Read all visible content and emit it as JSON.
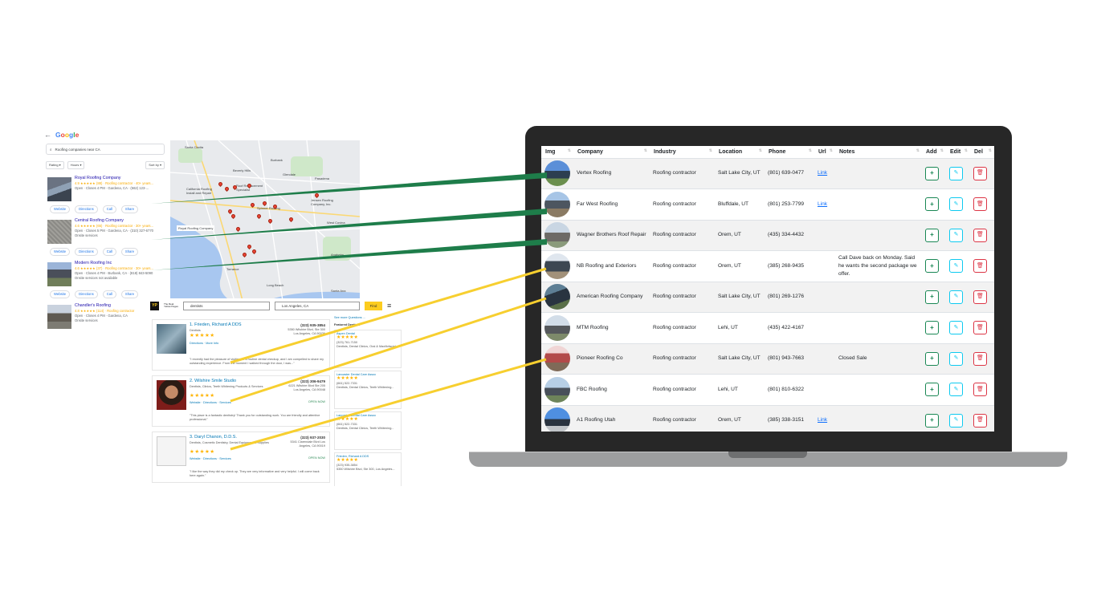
{
  "google": {
    "logo": [
      "G",
      "o",
      "o",
      "g",
      "l",
      "e"
    ],
    "search": "Roofing companies near CA",
    "filters": [
      "Rating ▾",
      "Hours ▾",
      "Sort by ▾"
    ],
    "results": [
      {
        "name": "Royal Roofing Company",
        "line1": "4.9 ★★★★★ (88) · Roofing contractor · 40+ years...",
        "line2": "Open · Closes 4 PM · Gardena, CA · (562) 123-...",
        "actions": [
          "Website",
          "Directions",
          "Call",
          "Share"
        ]
      },
      {
        "name": "Central Roofing Company",
        "line1": "4.6 ★★★★★ (65) · Roofing contractor · 30+ years...",
        "line2": "Open · Closes 5 PM · Gardena, CA · (310) 327-6770",
        "line3": "Onsite services",
        "actions": [
          "Website",
          "Directions",
          "Call",
          "Share"
        ]
      },
      {
        "name": "Modern Roofing Inc",
        "line1": "4.6 ★★★★★ (37) · Roofing contractor · 30+ years...",
        "line2": "Open · Closes 4 PM · Burbank, CA · (818) 843-5090",
        "line3": "Onsite services not available",
        "actions": [
          "Website",
          "Directions",
          "Call",
          "Share"
        ]
      },
      {
        "name": "Chandler's Roofing",
        "line1": "4.8 ★★★★★ (114) · Roofing contractor",
        "line2": "Open · Closes 4 PM · Gardena, CA",
        "line3": "Onsite services"
      }
    ],
    "map_labels": [
      "Santa Clarita",
      "California Roofing Install and Repair",
      "Roof Replacement Specialist",
      "Jensen Roofing Company, Inc.",
      "Spinner Roofing",
      "Royal Roofing Company",
      "Long Beach",
      "Santa Ana",
      "Torrance",
      "Anaheim",
      "Beverly Hills",
      "Glendale",
      "Pasadena",
      "Burbank",
      "West Covina"
    ]
  },
  "yellowpages": {
    "logo": "YP",
    "tagline": "The Real Yellow Pages",
    "search": "dentists",
    "location": "Los Angeles, CA",
    "find": "Find",
    "listings": [
      {
        "name": "1. Frieden, Richard A DDS",
        "sub": "Dentists",
        "phone": "(323) 935-3854",
        "addr": "5350 Wilshire Blvd, Ste 300 Los Angeles, CA 90036",
        "links": "Directions · More Info",
        "review": "\"I recently had the pleasure of visiting for a routine dental checkup, and I am compelled to share my outstanding experience. From the moment I walked through the door, I was...\""
      },
      {
        "name": "2. Wilshire Smile Studio",
        "sub": "Dentists, Clinics, Teeth Whitening Products & Services",
        "phone": "(323) 306-9479",
        "addr": "6221 Wilshire Blvd Ste 205 Los Angeles, CA 90048",
        "links": "Website · Directions · Services",
        "review": "\"This place is a fantastic dentistry! Thank you for outstanding work. You are friendly and attentive professional.\"",
        "status": "OPEN NOW"
      },
      {
        "name": "3. Daryl Chanon, D.D.S.",
        "sub": "Dentists, Cosmetic Dentistry, Dental Equipment & Supplies",
        "phone": "(323) 937-2030",
        "addr": "5341 Clarendale Blvd Los Angeles, CA 90019",
        "links": "Website · Directions · Services",
        "review": "\"I like the way they did my check up. They are very informative and very helpful. I will come back here again.\"",
        "status": "OPEN NOW"
      }
    ],
    "sidebar": {
      "heading": "Featured Dentists",
      "link": "See more Questions ...",
      "items": [
        {
          "name": "Aspen Dental",
          "phone": "(323) 761-7150",
          "desc": "Dentists, Dental Clinics, Oral & Maxillofacial..."
        },
        {
          "name": "Lancaster Dental Care Assoc",
          "phone": "(661) 522-7331",
          "desc": "Dentists, Dental Clinics, Teeth Whitening..."
        },
        {
          "name": "Lancaster Dental Care Assoc",
          "phone": "(661) 522-7331",
          "desc": "Dentists, Dental Clinics, Teeth Whitening..."
        },
        {
          "name": "Frieden, Richard A DDS",
          "phone": "(323) 935-3854",
          "desc": "5350 Wilshire Blvd, Ste 300, Los Angeles..."
        }
      ]
    }
  },
  "crm": {
    "columns": [
      "Img",
      "Company",
      "Industry",
      "Location",
      "Phone",
      "Url",
      "Notes",
      "Add",
      "Edit",
      "Del"
    ],
    "rows": [
      {
        "company": "Vertex Roofing",
        "industry": "Roofing contractor",
        "location": "Salt Lake City, UT",
        "phone": "(801) 639-0477",
        "url": "Link",
        "notes": ""
      },
      {
        "company": "Far West Roofing",
        "industry": "Roofing contractor",
        "location": "Bluffdale, UT",
        "phone": "(801) 253-7799",
        "url": "Link",
        "notes": ""
      },
      {
        "company": "Wagner Brothers Roof Repair",
        "industry": "Roofing contractor",
        "location": "Orem, UT",
        "phone": "(435) 334-4432",
        "url": "",
        "notes": ""
      },
      {
        "company": "NB Roofing and Exteriors",
        "industry": "Roofing contractor",
        "location": "Orem, UT",
        "phone": "(385) 268-9435",
        "url": "",
        "notes": "Call Dave back on Monday. Said he wants the second package we offer."
      },
      {
        "company": "American Roofing Company",
        "industry": "Roofing contractor",
        "location": "Salt Lake City, UT",
        "phone": "(801) 269-1276",
        "url": "",
        "notes": ""
      },
      {
        "company": "MTM Roofing",
        "industry": "Roofing contractor",
        "location": "Lehi, UT",
        "phone": "(435) 422-4167",
        "url": "",
        "notes": ""
      },
      {
        "company": "Pioneer Roofing Co",
        "industry": "Roofing contractor",
        "location": "Salt Lake City, UT",
        "phone": "(801) 943-7663",
        "url": "",
        "notes": "Closed Sale"
      },
      {
        "company": "FBC Roofing",
        "industry": "Roofing contractor",
        "location": "Lehi, UT",
        "phone": "(801) 810-6322",
        "url": "",
        "notes": ""
      },
      {
        "company": "A1 Roofing Utah",
        "industry": "Roofing contractor",
        "location": "Orem, UT",
        "phone": "(385) 338-3151",
        "url": "Link",
        "notes": ""
      }
    ],
    "buttons": {
      "add": "+",
      "edit": "✎",
      "del": "🗑"
    }
  },
  "colors": {
    "green_line": "#1e7d4a",
    "yellow_line": "#f7cf2f",
    "add": "#198754",
    "edit": "#0dcaf0",
    "del": "#dc3545"
  }
}
